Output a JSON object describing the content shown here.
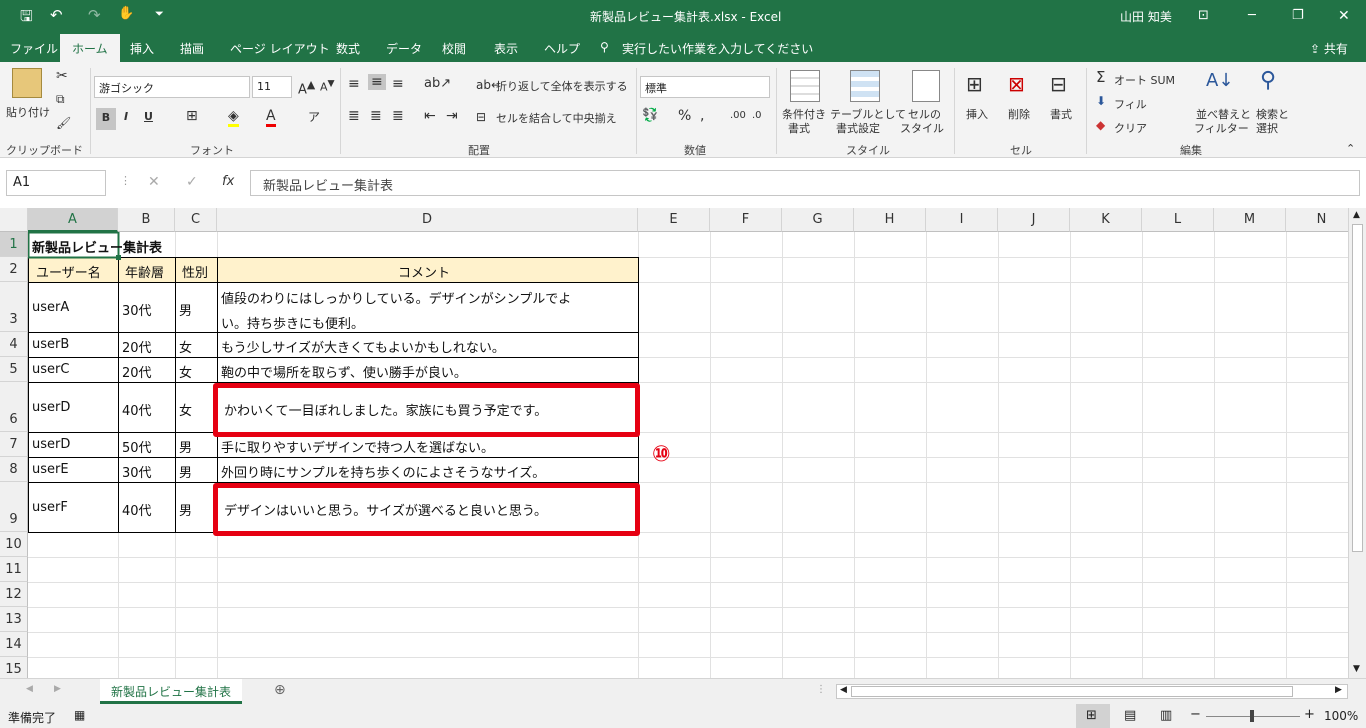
{
  "titlebar": {
    "title": "新製品レビュー集計表.xlsx  -  Excel",
    "user": "山田 知美"
  },
  "tabs": [
    "ファイル",
    "ホーム",
    "挿入",
    "描画",
    "ページ レイアウト",
    "数式",
    "データ",
    "校閲",
    "表示",
    "ヘルプ"
  ],
  "tell_me": "実行したい作業を入力してください",
  "share": "共有",
  "ribbon": {
    "paste": "貼り付け",
    "font_name": "游ゴシック",
    "font_size": "11",
    "wrap_text": "折り返して全体を表示する",
    "merge_center": "セルを結合して中央揃え",
    "number_format": "標準",
    "cond_format": [
      "条件付き",
      "書式"
    ],
    "table_format": [
      "テーブルとして",
      "書式設定"
    ],
    "cell_styles": [
      "セルの",
      "スタイル"
    ],
    "insert": "挿入",
    "delete": "削除",
    "format": "書式",
    "autosum": "オート SUM",
    "fill": "フィル",
    "clear": "クリア",
    "sort_filter": [
      "並べ替えと",
      "フィルター"
    ],
    "find_select": [
      "検索と",
      "選択"
    ],
    "groups": {
      "clipboard": "クリップボード",
      "font": "フォント",
      "alignment": "配置",
      "number": "数値",
      "styles": "スタイル",
      "cells": "セル",
      "editing": "編集"
    }
  },
  "formula_bar": {
    "name_box": "A1",
    "fx": "fx",
    "content": "新製品レビュー集計表"
  },
  "columns": [
    "A",
    "B",
    "C",
    "D",
    "E",
    "F",
    "G",
    "H",
    "I",
    "J",
    "K",
    "L",
    "M",
    "N"
  ],
  "rows": [
    "1",
    "2",
    "3",
    "4",
    "5",
    "6",
    "7",
    "8",
    "9",
    "10",
    "11",
    "12",
    "13",
    "14",
    "15"
  ],
  "sheet": {
    "title": "新製品レビュー集計表",
    "headers": [
      "ユーザー名",
      "年齢層",
      "性別",
      "コメント"
    ],
    "data": [
      {
        "user": "userA",
        "age": "30代",
        "sex": "男",
        "comment_lines": [
          "値段のわりにはしっかりしている。デザインがシンプルでよ",
          "い。持ち歩きにも便利。"
        ]
      },
      {
        "user": "userB",
        "age": "20代",
        "sex": "女",
        "comment_lines": [
          "もう少しサイズが大きくてもよいかもしれない。"
        ]
      },
      {
        "user": "userC",
        "age": "20代",
        "sex": "女",
        "comment_lines": [
          "鞄の中で場所を取らず、使い勝手が良い。"
        ]
      },
      {
        "user": "userD",
        "age": "40代",
        "sex": "女",
        "comment_lines": [
          "かわいくて一目ぼれしました。家族にも買う予定です。"
        ]
      },
      {
        "user": "userD",
        "age": "50代",
        "sex": "男",
        "comment_lines": [
          "手に取りやすいデザインで持つ人を選ばない。"
        ]
      },
      {
        "user": "userE",
        "age": "30代",
        "sex": "男",
        "comment_lines": [
          "外回り時にサンプルを持ち歩くのによさそうなサイズ。"
        ]
      },
      {
        "user": "userF",
        "age": "40代",
        "sex": "男",
        "comment_lines": [
          "デザインはいいと思う。サイズが選べると良いと思う。"
        ]
      }
    ]
  },
  "annotation": "⑩",
  "sheet_tab": "新製品レビュー集計表",
  "status": {
    "ready": "準備完了",
    "zoom": "100%"
  },
  "colors": {
    "excel_green": "#217346",
    "highlight_red": "#e60012",
    "header_fill": "#fff2cc"
  }
}
